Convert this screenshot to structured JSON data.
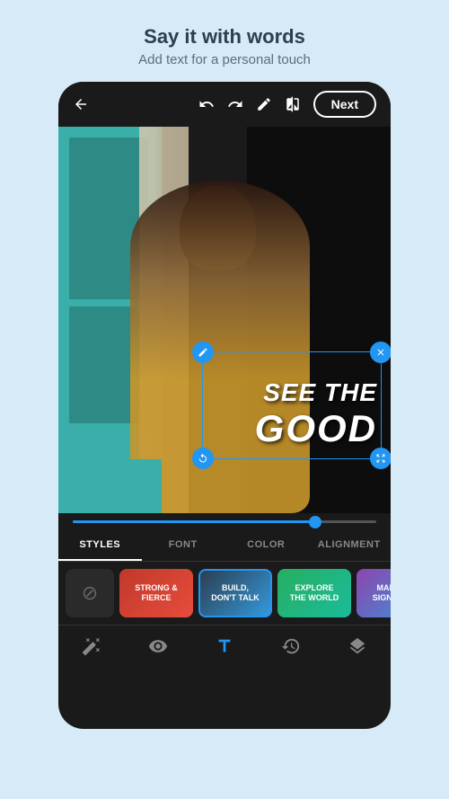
{
  "page": {
    "background_color": "#d6eaf8",
    "title": "Say it with words",
    "subtitle": "Add text for a personal touch"
  },
  "toolbar": {
    "back_icon": "←",
    "undo_icon": "↺",
    "redo_icon": "↻",
    "edit_icon": "✎",
    "compare_icon": "⊡",
    "next_button": "Next"
  },
  "text_overlay": {
    "line1": "SEE THE",
    "line2": "GOOD"
  },
  "tabs": {
    "styles": "STYLES",
    "font": "FONT",
    "color": "COLOR",
    "alignment": "ALIGNMENT"
  },
  "presets": [
    {
      "id": "none",
      "label": "⊘"
    },
    {
      "id": "strong",
      "label": "STRONG &\nFIERCE",
      "selected": false
    },
    {
      "id": "build",
      "label": "BUILD,\nDON'T TALK",
      "selected": true
    },
    {
      "id": "explore",
      "label": "EXPLORE\nTHE WORLD",
      "selected": false
    },
    {
      "id": "make",
      "label": "MAKE IT\nSIGNIFIC...",
      "selected": false
    }
  ],
  "bottom_toolbar": {
    "icons": [
      "wand",
      "eye",
      "text",
      "history",
      "layers"
    ]
  }
}
